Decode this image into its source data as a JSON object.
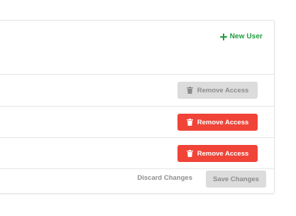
{
  "header": {
    "new_user_label": "New User",
    "icon": "plus-icon",
    "accent_color": "#1f9b3c"
  },
  "rows": [
    {
      "remove_label": "Remove Access",
      "state": "disabled"
    },
    {
      "remove_label": "Remove Access",
      "state": "active"
    },
    {
      "remove_label": "Remove Access",
      "state": "active"
    }
  ],
  "footer": {
    "discard_label": "Discard Changes",
    "save_label": "Save Changes",
    "save_state": "disabled"
  },
  "colors": {
    "danger": "#f04438",
    "disabled_bg": "#dcdcdc",
    "disabled_text": "#8c8c8c"
  }
}
